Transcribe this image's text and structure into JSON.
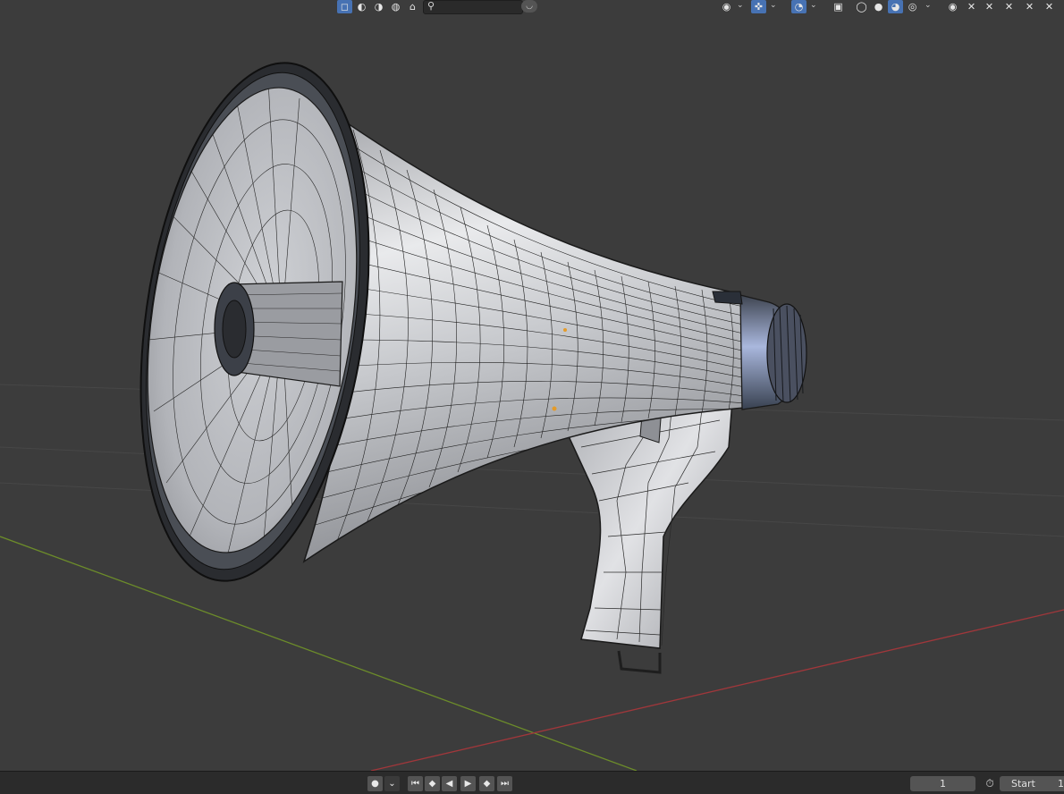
{
  "header": {
    "search": {
      "value": "",
      "placeholder": ""
    },
    "search_icon": "magnifier-icon",
    "view_object_types_icon": "eye-icon",
    "gizmo_icon": "gizmo-icon",
    "overlay_icon": "overlay-icon",
    "xray_icon": "xray-icon",
    "shading_modes": [
      "wireframe",
      "solid",
      "material-preview",
      "rendered"
    ],
    "active_shading": "material-preview"
  },
  "timeline": {
    "playback_buttons": [
      "jump-to-start",
      "jump-to-keyframe-prev",
      "play-reverse",
      "play",
      "jump-to-keyframe-next",
      "jump-to-end"
    ],
    "current_frame": "1",
    "start_label": "Start",
    "start_value": "1"
  },
  "colors": {
    "viewport_bg": "#3c3c3c",
    "accent": "#4772b3",
    "x_axis": "#a0373b",
    "y_axis": "#6c8c2a"
  }
}
